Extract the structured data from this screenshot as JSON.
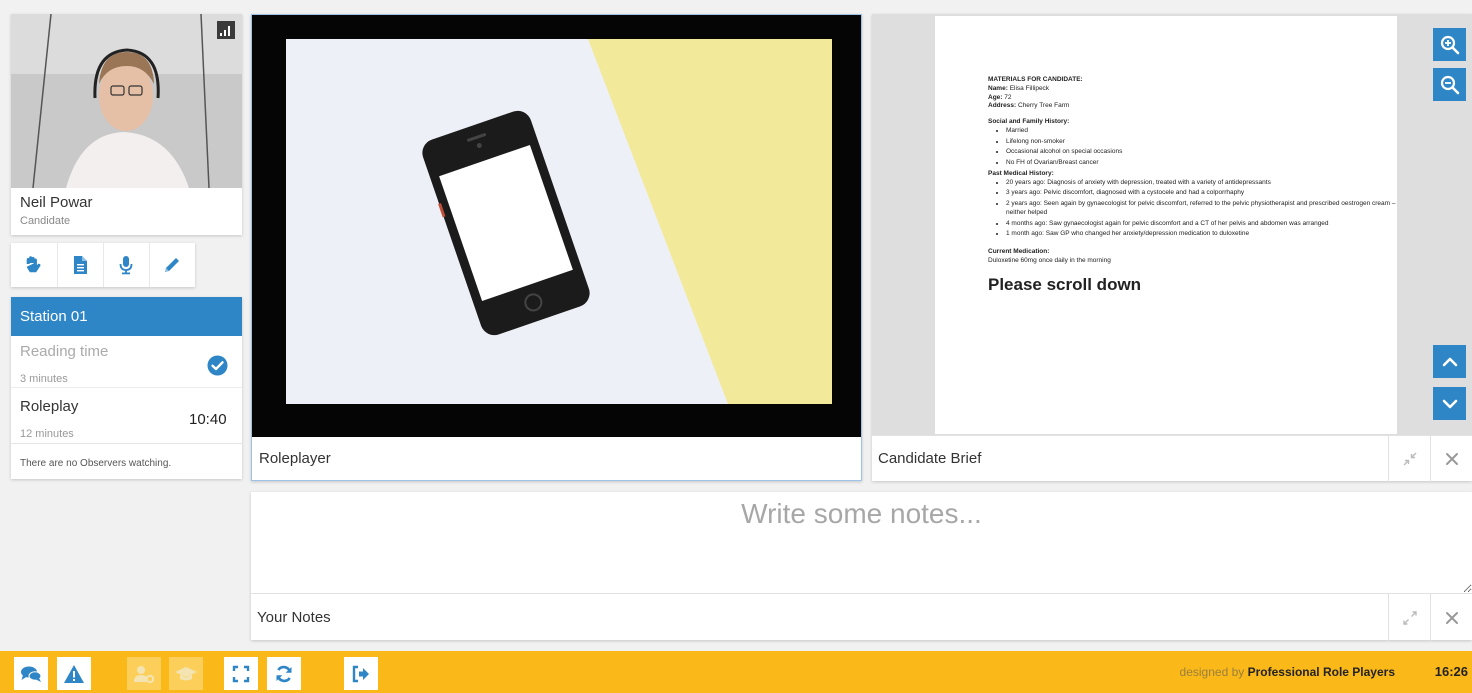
{
  "candidate": {
    "name": "Neil Powar",
    "role": "Candidate"
  },
  "tools": [
    "raise-hand-icon",
    "document-icon",
    "microphone-icon",
    "pencil-icon"
  ],
  "station": {
    "title": "Station 01",
    "phases": [
      {
        "name": "Reading time",
        "duration": "3 minutes",
        "completed": true,
        "timer": ""
      },
      {
        "name": "Roleplay",
        "duration": "12 minutes",
        "completed": false,
        "timer": "10:40"
      }
    ],
    "observers_text": "There are no Observers watching."
  },
  "roleplayer": {
    "label": "Roleplayer"
  },
  "brief": {
    "label": "Candidate Brief",
    "doc": {
      "heading": "MATERIALS FOR CANDIDATE:",
      "name_label": "Name:",
      "name_value": "Elisa Fillipeck",
      "age_label": "Age:",
      "age_value": "72",
      "address_label": "Address:",
      "address_value": "Cherry Tree Farm",
      "social_heading": "Social and Family History:",
      "social_items": [
        "Married",
        "Lifelong non-smoker",
        "Occasional alcohol on special occasions",
        "No FH of Ovarian/Breast cancer"
      ],
      "pmh_heading": "Past Medical History:",
      "pmh_items": [
        "20 years ago: Diagnosis of anxiety with depression, treated with a variety of antidepressants",
        "3 years ago: Pelvic discomfort, diagnosed with a cystocele and had a colporrhaphy",
        "2 years ago: Seen again by gynaecologist for pelvic discomfort, referred to the pelvic physiotherapist and prescribed oestrogen cream – neither helped",
        "4 months ago: Saw gynaecologist again for pelvic discomfort and a CT of her pelvis and abdomen was arranged",
        "1 month ago: Saw GP who changed her anxiety/depression medication to duloxetine"
      ],
      "med_heading": "Current Medication:",
      "med_value": "Duloxetine 60mg once daily in the morning",
      "scroll_prompt": "Please scroll down"
    }
  },
  "notes": {
    "placeholder": "Write some notes...",
    "label": "Your Notes"
  },
  "bottombar": {
    "credit_prefix": "designed by",
    "credit_brand": "Professional Role Players",
    "clock": "16:26"
  },
  "colors": {
    "accent_blue": "#2f86c7",
    "bar_yellow": "#fbb819"
  }
}
